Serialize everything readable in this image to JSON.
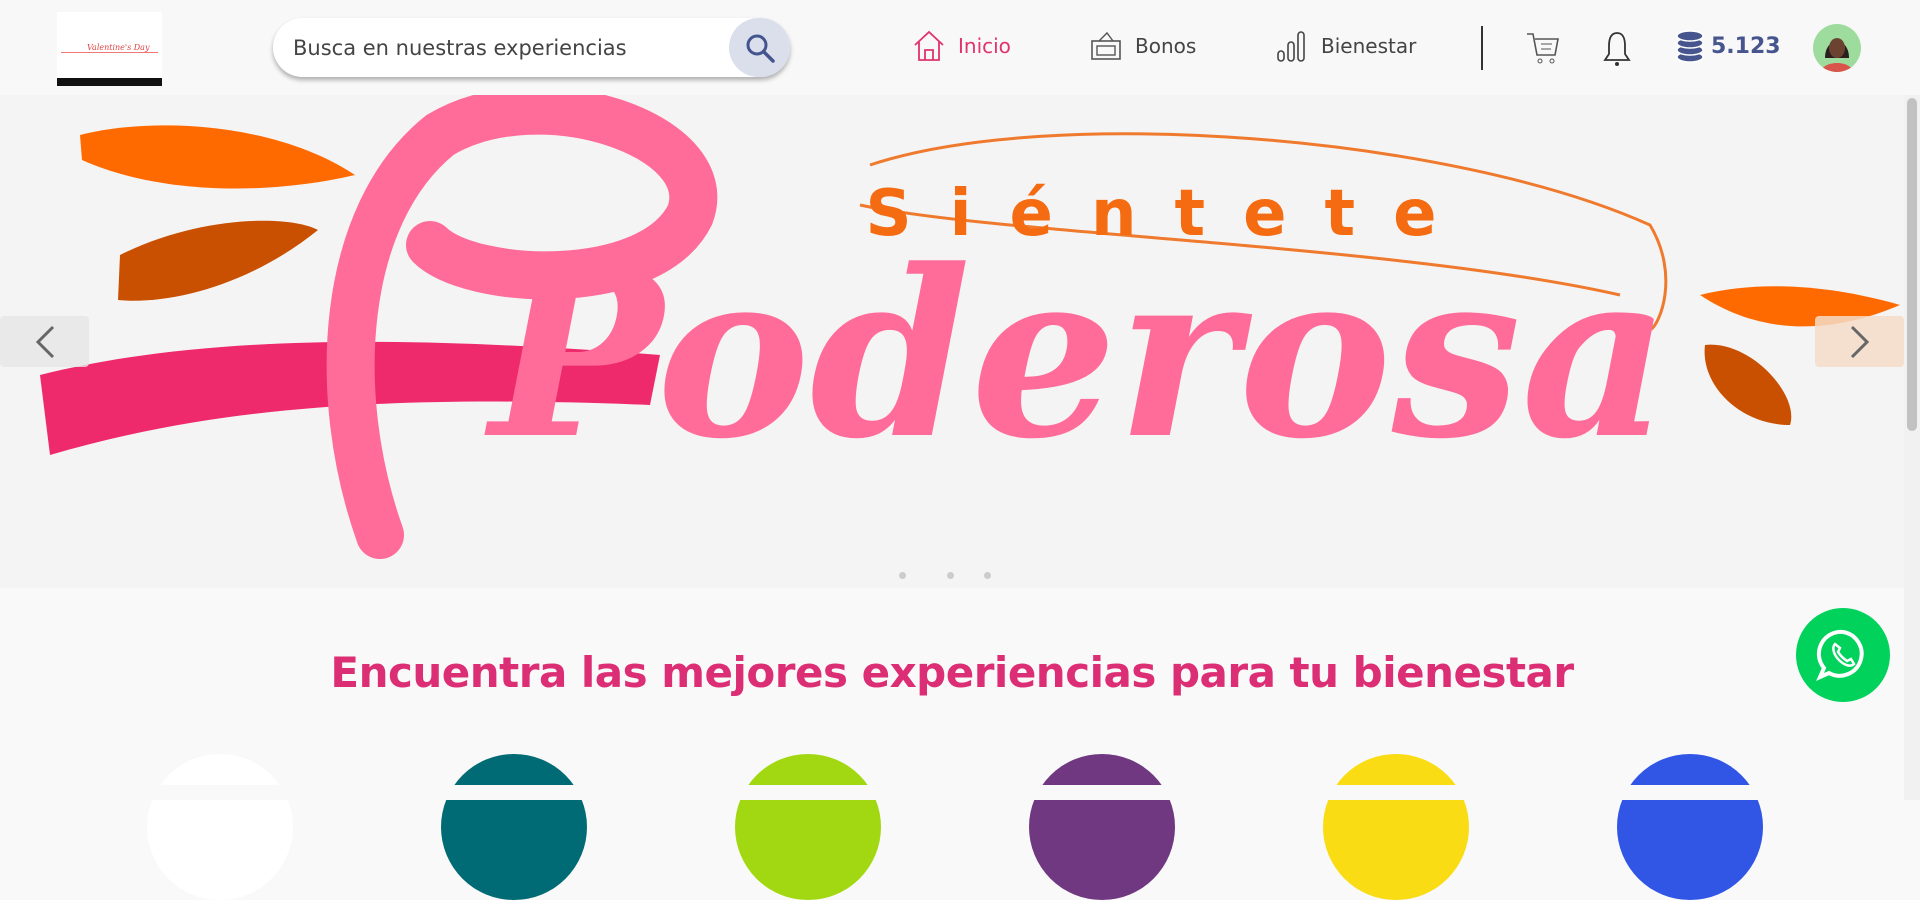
{
  "header": {
    "logo_text": "Valentine's Day",
    "search": {
      "placeholder": "Busca en nuestras experiencias",
      "value": ""
    },
    "nav": [
      {
        "label": "Inicio",
        "icon": "home-icon",
        "active": true
      },
      {
        "label": "Bonos",
        "icon": "voucher-icon",
        "active": false
      },
      {
        "label": "Bienestar",
        "icon": "bar-chart-icon",
        "active": false
      }
    ],
    "coins": "5.123"
  },
  "banner": {
    "line1": "Siéntete",
    "line2": "Poderosa",
    "slide_count": 3,
    "active_slide": 1
  },
  "main": {
    "heading": "Encuentra las mejores experiencias para tu bienestar",
    "category_colors": [
      "#ffffff",
      "#006b74",
      "#a2d812",
      "#6f3881",
      "#fadc14",
      "#3156e6"
    ]
  },
  "colors": {
    "accent": "#dc2e74",
    "whatsapp": "#00d25b",
    "coins": "#47558f"
  }
}
